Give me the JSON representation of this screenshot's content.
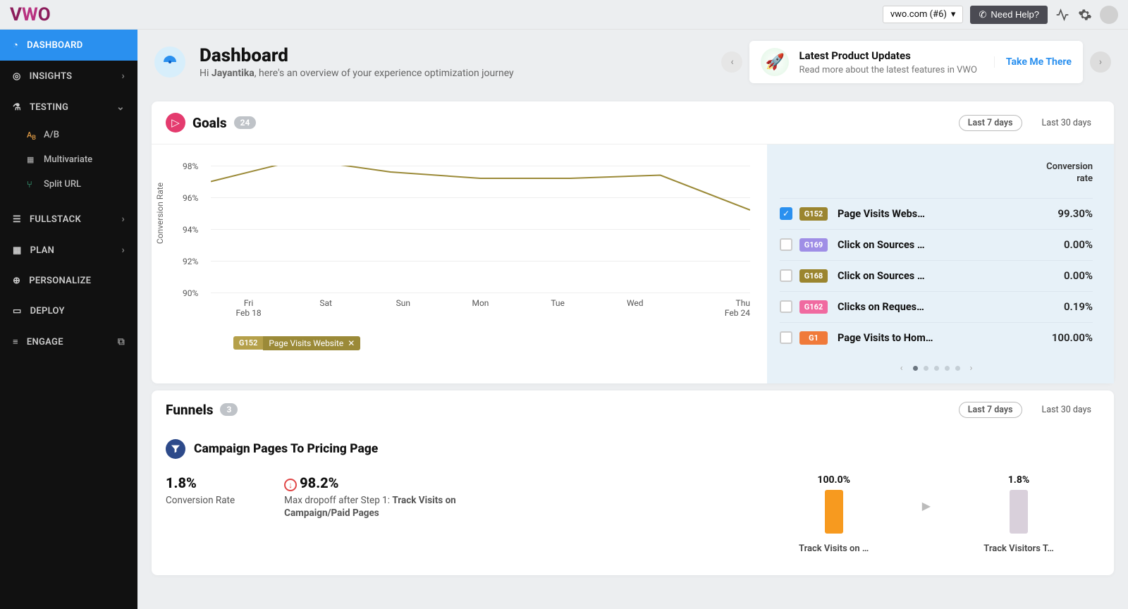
{
  "topbar": {
    "site_selector": "vwo.com (#6)",
    "help_label": "Need Help?"
  },
  "sidebar": {
    "dashboard": "DASHBOARD",
    "insights": "INSIGHTS",
    "testing": "TESTING",
    "testing_sub": {
      "ab": "A/B",
      "mv": "Multivariate",
      "split": "Split URL"
    },
    "fullstack": "FULLSTACK",
    "plan": "PLAN",
    "personalize": "PERSONALIZE",
    "deploy": "DEPLOY",
    "engage": "ENGAGE"
  },
  "header": {
    "title": "Dashboard",
    "greeting_prefix": "Hi ",
    "user_name": "Jayantika",
    "greeting_suffix": ", here's an overview of your experience optimization journey",
    "update_title": "Latest Product Updates",
    "update_sub": "Read more about the latest features in VWO",
    "takeme": "Take Me There"
  },
  "goals": {
    "title": "Goals",
    "count": "24",
    "range7": "Last 7 days",
    "range30": "Last 30 days",
    "ylabel": "Conversion Rate",
    "cr_header_l1": "Conversion",
    "cr_header_l2": "rate",
    "chip_id": "G152",
    "chip_label": "Page Visits Website",
    "xaxis_l1_0": "Fri",
    "xaxis_l2_0": "Feb 18",
    "xaxis_l1_1": "Sat",
    "xaxis_l1_2": "Sun",
    "xaxis_l1_3": "Mon",
    "xaxis_l1_4": "Tue",
    "xaxis_l1_5": "Wed",
    "xaxis_l1_6": "Thu",
    "xaxis_l2_6": "Feb 24",
    "items": [
      {
        "id": "G152",
        "name": "Page Visits Webs…",
        "rate": "99.30%",
        "color": "#9b852f",
        "checked": true
      },
      {
        "id": "G169",
        "name": "Click on Sources …",
        "rate": "0.00%",
        "color": "#9f8ee6",
        "checked": false
      },
      {
        "id": "G168",
        "name": "Click on Sources …",
        "rate": "0.00%",
        "color": "#9b852f",
        "checked": false
      },
      {
        "id": "G162",
        "name": "Clicks on Reques…",
        "rate": "0.19%",
        "color": "#f06aa0",
        "checked": false
      },
      {
        "id": "G1",
        "name": "Page Visits to Hom…",
        "rate": "100.00%",
        "color": "#f07a3a",
        "checked": false
      }
    ]
  },
  "funnels": {
    "title": "Funnels",
    "count": "3",
    "range7": "Last 7 days",
    "range30": "Last 30 days",
    "campaign_title": "Campaign Pages To Pricing Page",
    "conv_val": "1.8%",
    "conv_lbl": "Conversion Rate",
    "drop_val": "98.2%",
    "drop_prefix": "Max dropoff after Step 1: ",
    "drop_bold": "Track Visits on Campaign/Paid Pages",
    "bar1_val": "100.0%",
    "bar1_lbl": "Track Visits on …",
    "bar2_val": "1.8%",
    "bar2_lbl": "Track Visitors T…"
  },
  "chart_data": {
    "type": "line",
    "title": "Conversion Rate — Page Visits Website (G152)",
    "xlabel": "",
    "ylabel": "Conversion Rate",
    "categories": [
      "Fri Feb 18",
      "Sat",
      "Sun",
      "Mon",
      "Tue",
      "Wed",
      "Thu Feb 24"
    ],
    "series": [
      {
        "name": "G152 Page Visits Website",
        "values": [
          97.0,
          98.4,
          97.6,
          97.2,
          97.2,
          97.4,
          95.2
        ]
      }
    ],
    "ylim": [
      90,
      98
    ],
    "yticks": [
      90,
      92,
      94,
      96,
      98
    ]
  }
}
